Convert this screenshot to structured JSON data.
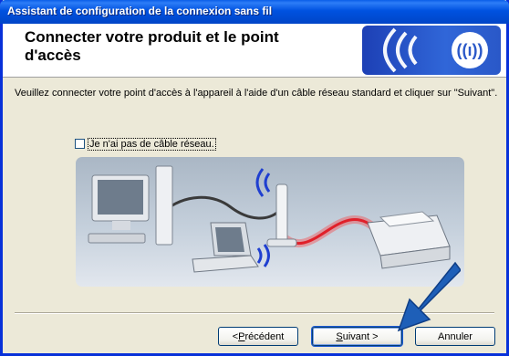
{
  "window": {
    "title": "Assistant de configuration de la connexion sans fil"
  },
  "header": {
    "heading": "Connecter votre produit et le point d'accès"
  },
  "main": {
    "instructions": "Veuillez connecter votre point d'accès à l'appareil à l'aide d'un câble réseau standard et cliquer sur \"Suivant\".",
    "checkbox": {
      "label": "Je n'ai pas de câble réseau.",
      "checked": false
    }
  },
  "buttons": {
    "previous_accel": "P",
    "previous_rest": "récédent",
    "previous_prefix": "< ",
    "next_accel": "S",
    "next_rest": "uivant >",
    "cancel": "Annuler"
  },
  "colors": {
    "titlebar": "#0052e0",
    "window_bg": "#ece9d8",
    "banner": "#2a58c8",
    "arrow": "#1e5fb8",
    "cable_red": "#e0202a"
  },
  "icons": [
    "wireless-signal-icon",
    "computer-icon",
    "laptop-icon",
    "access-point-icon",
    "printer-icon",
    "pointer-arrow-icon"
  ]
}
